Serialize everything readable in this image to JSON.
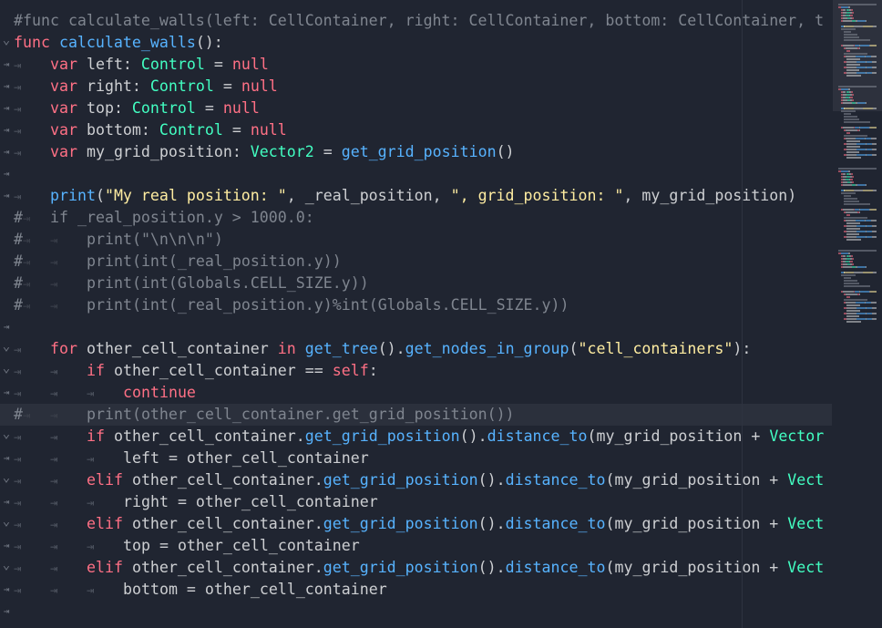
{
  "editor": {
    "lines": [
      {
        "gutter": "",
        "marker": "",
        "segments": [
          {
            "t": "#func calculate_walls(left: CellContainer, right: CellContainer, bottom: CellContainer, t",
            "c": "cm"
          }
        ]
      },
      {
        "gutter": "fold",
        "marker": "",
        "segments": [
          {
            "t": "func ",
            "c": "kw"
          },
          {
            "t": "calculate_walls",
            "c": "fn"
          },
          {
            "t": "():",
            "c": "plain"
          }
        ]
      },
      {
        "gutter": "tab",
        "marker": "",
        "indent": 1,
        "segments": [
          {
            "t": "var ",
            "c": "kw"
          },
          {
            "t": "left: ",
            "c": "plain"
          },
          {
            "t": "Control",
            "c": "cls"
          },
          {
            "t": " = ",
            "c": "plain"
          },
          {
            "t": "null",
            "c": "kw"
          }
        ]
      },
      {
        "gutter": "tab",
        "marker": "",
        "indent": 1,
        "segments": [
          {
            "t": "var ",
            "c": "kw"
          },
          {
            "t": "right: ",
            "c": "plain"
          },
          {
            "t": "Control",
            "c": "cls"
          },
          {
            "t": " = ",
            "c": "plain"
          },
          {
            "t": "null",
            "c": "kw"
          }
        ]
      },
      {
        "gutter": "tab",
        "marker": "",
        "indent": 1,
        "segments": [
          {
            "t": "var ",
            "c": "kw"
          },
          {
            "t": "top: ",
            "c": "plain"
          },
          {
            "t": "Control",
            "c": "cls"
          },
          {
            "t": " = ",
            "c": "plain"
          },
          {
            "t": "null",
            "c": "kw"
          }
        ]
      },
      {
        "gutter": "tab",
        "marker": "",
        "indent": 1,
        "segments": [
          {
            "t": "var ",
            "c": "kw"
          },
          {
            "t": "bottom: ",
            "c": "plain"
          },
          {
            "t": "Control",
            "c": "cls"
          },
          {
            "t": " = ",
            "c": "plain"
          },
          {
            "t": "null",
            "c": "kw"
          }
        ]
      },
      {
        "gutter": "tab",
        "marker": "",
        "indent": 1,
        "segments": [
          {
            "t": "var ",
            "c": "kw"
          },
          {
            "t": "my_grid_position: ",
            "c": "plain"
          },
          {
            "t": "Vector2",
            "c": "cls"
          },
          {
            "t": " = ",
            "c": "plain"
          },
          {
            "t": "get_grid_position",
            "c": "fn"
          },
          {
            "t": "()",
            "c": "plain"
          }
        ]
      },
      {
        "gutter": "tab",
        "marker": "",
        "indent": 0,
        "segments": []
      },
      {
        "gutter": "tab",
        "marker": "",
        "indent": 1,
        "segments": [
          {
            "t": "print",
            "c": "fn"
          },
          {
            "t": "(",
            "c": "plain"
          },
          {
            "t": "\"My real position: \"",
            "c": "str"
          },
          {
            "t": ", _real_position, ",
            "c": "plain"
          },
          {
            "t": "\", grid_position: \"",
            "c": "str"
          },
          {
            "t": ", my_grid_position)",
            "c": "plain"
          }
        ]
      },
      {
        "gutter": "",
        "marker": "#",
        "indent": 1,
        "segments": [
          {
            "t": "if _real_position.y > 1000.0:",
            "c": "cm"
          }
        ]
      },
      {
        "gutter": "",
        "marker": "#",
        "indent": 2,
        "segments": [
          {
            "t": "print(\"\\n\\n\\n\")",
            "c": "cm"
          }
        ]
      },
      {
        "gutter": "",
        "marker": "#",
        "indent": 2,
        "segments": [
          {
            "t": "print(int(_real_position.y))",
            "c": "cm"
          }
        ]
      },
      {
        "gutter": "",
        "marker": "#",
        "indent": 2,
        "segments": [
          {
            "t": "print(int(Globals.CELL_SIZE.y))",
            "c": "cm"
          }
        ]
      },
      {
        "gutter": "",
        "marker": "#",
        "indent": 2,
        "segments": [
          {
            "t": "print(int(_real_position.y)%int(Globals.CELL_SIZE.y))",
            "c": "cm"
          }
        ]
      },
      {
        "gutter": "tab",
        "marker": "",
        "indent": 0,
        "segments": []
      },
      {
        "gutter": "fold",
        "marker": "",
        "indent": 1,
        "segments": [
          {
            "t": "for ",
            "c": "kw"
          },
          {
            "t": "other_cell_container ",
            "c": "plain"
          },
          {
            "t": "in ",
            "c": "kw"
          },
          {
            "t": "get_tree",
            "c": "fn"
          },
          {
            "t": "().",
            "c": "plain"
          },
          {
            "t": "get_nodes_in_group",
            "c": "fn"
          },
          {
            "t": "(",
            "c": "plain"
          },
          {
            "t": "\"cell_containers\"",
            "c": "str"
          },
          {
            "t": "):",
            "c": "plain"
          }
        ]
      },
      {
        "gutter": "fold",
        "marker": "",
        "indent": 2,
        "segments": [
          {
            "t": "if ",
            "c": "kw"
          },
          {
            "t": "other_cell_container == ",
            "c": "plain"
          },
          {
            "t": "self",
            "c": "kw"
          },
          {
            "t": ":",
            "c": "plain"
          }
        ]
      },
      {
        "gutter": "tab",
        "marker": "",
        "indent": 3,
        "segments": [
          {
            "t": "continue",
            "c": "kw"
          }
        ]
      },
      {
        "gutter": "",
        "marker": "#",
        "indent": 2,
        "current": true,
        "segments": [
          {
            "t": "print(other_cell_container.get_grid_position())",
            "c": "cm"
          }
        ]
      },
      {
        "gutter": "fold",
        "marker": "",
        "indent": 2,
        "segments": [
          {
            "t": "if ",
            "c": "kw"
          },
          {
            "t": "other_cell_container.",
            "c": "plain"
          },
          {
            "t": "get_grid_position",
            "c": "fn"
          },
          {
            "t": "().",
            "c": "plain"
          },
          {
            "t": "distance_to",
            "c": "fn"
          },
          {
            "t": "(my_grid_position + ",
            "c": "plain"
          },
          {
            "t": "Vector",
            "c": "cls"
          }
        ]
      },
      {
        "gutter": "tab",
        "marker": "",
        "indent": 3,
        "segments": [
          {
            "t": "left = other_cell_container",
            "c": "plain"
          }
        ]
      },
      {
        "gutter": "fold",
        "marker": "",
        "indent": 2,
        "segments": [
          {
            "t": "elif ",
            "c": "kw"
          },
          {
            "t": "other_cell_container.",
            "c": "plain"
          },
          {
            "t": "get_grid_position",
            "c": "fn"
          },
          {
            "t": "().",
            "c": "plain"
          },
          {
            "t": "distance_to",
            "c": "fn"
          },
          {
            "t": "(my_grid_position + ",
            "c": "plain"
          },
          {
            "t": "Vect",
            "c": "cls"
          }
        ]
      },
      {
        "gutter": "tab",
        "marker": "",
        "indent": 3,
        "segments": [
          {
            "t": "right = other_cell_container",
            "c": "plain"
          }
        ]
      },
      {
        "gutter": "fold",
        "marker": "",
        "indent": 2,
        "segments": [
          {
            "t": "elif ",
            "c": "kw"
          },
          {
            "t": "other_cell_container.",
            "c": "plain"
          },
          {
            "t": "get_grid_position",
            "c": "fn"
          },
          {
            "t": "().",
            "c": "plain"
          },
          {
            "t": "distance_to",
            "c": "fn"
          },
          {
            "t": "(my_grid_position + ",
            "c": "plain"
          },
          {
            "t": "Vect",
            "c": "cls"
          }
        ]
      },
      {
        "gutter": "tab",
        "marker": "",
        "indent": 3,
        "segments": [
          {
            "t": "top = other_cell_container",
            "c": "plain"
          }
        ]
      },
      {
        "gutter": "fold",
        "marker": "",
        "indent": 2,
        "segments": [
          {
            "t": "elif ",
            "c": "kw"
          },
          {
            "t": "other_cell_container.",
            "c": "plain"
          },
          {
            "t": "get_grid_position",
            "c": "fn"
          },
          {
            "t": "().",
            "c": "plain"
          },
          {
            "t": "distance_to",
            "c": "fn"
          },
          {
            "t": "(my_grid_position + ",
            "c": "plain"
          },
          {
            "t": "Vect",
            "c": "cls"
          }
        ]
      },
      {
        "gutter": "tab",
        "marker": "",
        "indent": 3,
        "segments": [
          {
            "t": "bottom = other_cell_container",
            "c": "plain"
          }
        ]
      },
      {
        "gutter": "tab",
        "marker": "",
        "indent": 0,
        "segments": []
      }
    ]
  },
  "colors": {
    "background": "#202531",
    "current_line": "#2b303c",
    "keyword": "#ff7085",
    "class": "#42ffc2",
    "function": "#57b3ff",
    "string": "#ffeda1",
    "comment": "#7f858f",
    "text": "#cdcfd2"
  },
  "icons": {
    "fold": "chevron-down-icon",
    "tab": "tab-arrow-icon"
  }
}
